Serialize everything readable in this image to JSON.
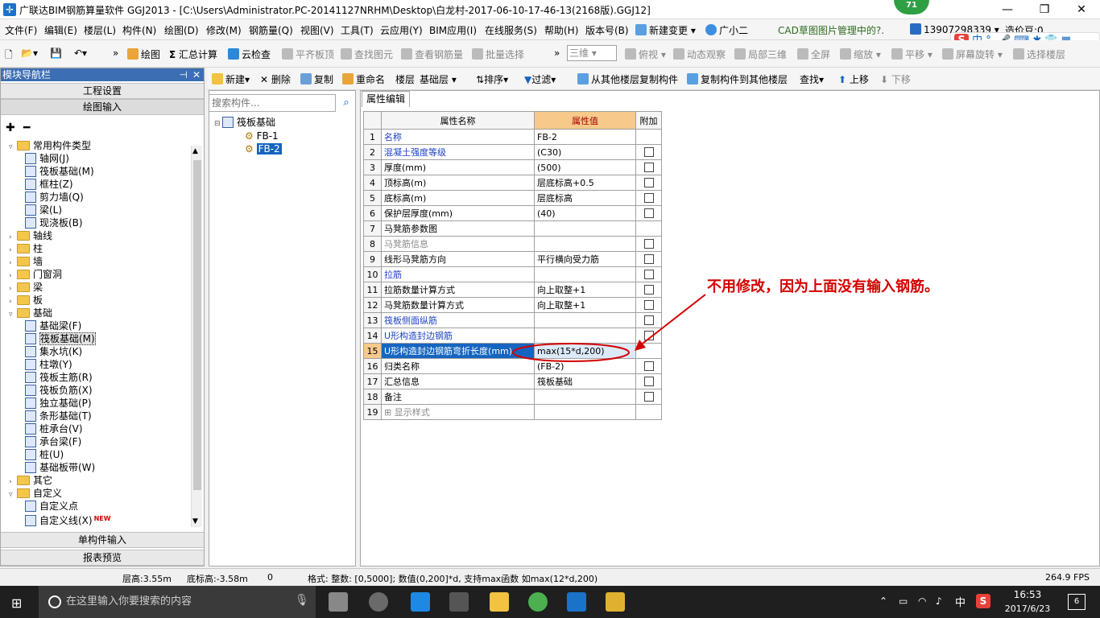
{
  "window": {
    "title": "广联达BIM钢筋算量软件 GGJ2013 - [C:\\Users\\Administrator.PC-20141127NRHM\\Desktop\\白龙村-2017-06-10-17-46-13(2168版).GGJ12]",
    "badge": "71"
  },
  "menu": {
    "items": [
      "文件(F)",
      "编辑(E)",
      "楼层(L)",
      "构件(N)",
      "绘图(D)",
      "修改(M)",
      "钢筋量(Q)",
      "视图(V)",
      "工具(T)",
      "云应用(Y)",
      "BIM应用(I)",
      "在线服务(S)",
      "帮助(H)",
      "版本号(B)",
      "新建变更",
      "广小二"
    ],
    "cad_notice": "CAD草图图片管理中的?.",
    "phone": "13907298339",
    "price": "造价豆:0"
  },
  "toolbar1": {
    "draw": "绘图",
    "sum": "汇总计算",
    "cloud_check": "云检查",
    "flat_top": "平齐板顶",
    "find_elem": "查找图元",
    "view_rebar": "查看钢筋量",
    "batch_select": "批量选择",
    "view_mode": "三维",
    "top_view": "俯视",
    "dynamic": "动态观察",
    "local3d": "局部三维",
    "fullscreen": "全屏",
    "zoom": "缩放",
    "pan": "平移",
    "rotate": "屏幕旋转",
    "select_floor": "选择楼层"
  },
  "toolbar2": {
    "new": "新建",
    "delete": "删除",
    "copy": "复制",
    "rename": "重命名",
    "floor_label": "楼层",
    "floor_value": "基础层",
    "sort": "排序",
    "filter": "过滤",
    "copy_from": "从其他楼层复制构件",
    "copy_to": "复制构件到其他楼层",
    "find": "查找",
    "move_up": "上移",
    "move_down": "下移"
  },
  "nav": {
    "header": "模块导航栏",
    "project_settings": "工程设置",
    "drawing_input": "绘图输入",
    "single_input": "单构件输入",
    "report_preview": "报表预览",
    "tree": [
      {
        "label": "常用构件类型",
        "level": 0,
        "type": "folder",
        "expanded": true
      },
      {
        "label": "轴网(J)",
        "level": 1,
        "type": "item"
      },
      {
        "label": "筏板基础(M)",
        "level": 1,
        "type": "item"
      },
      {
        "label": "框柱(Z)",
        "level": 1,
        "type": "item"
      },
      {
        "label": "剪力墙(Q)",
        "level": 1,
        "type": "item"
      },
      {
        "label": "梁(L)",
        "level": 1,
        "type": "item"
      },
      {
        "label": "现浇板(B)",
        "level": 1,
        "type": "item"
      },
      {
        "label": "轴线",
        "level": 0,
        "type": "folder",
        "expanded": false
      },
      {
        "label": "柱",
        "level": 0,
        "type": "folder",
        "expanded": false
      },
      {
        "label": "墙",
        "level": 0,
        "type": "folder",
        "expanded": false
      },
      {
        "label": "门窗洞",
        "level": 0,
        "type": "folder",
        "expanded": false
      },
      {
        "label": "梁",
        "level": 0,
        "type": "folder",
        "expanded": false
      },
      {
        "label": "板",
        "level": 0,
        "type": "folder",
        "expanded": false
      },
      {
        "label": "基础",
        "level": 0,
        "type": "folder",
        "expanded": true
      },
      {
        "label": "基础梁(F)",
        "level": 1,
        "type": "item"
      },
      {
        "label": "筏板基础(M)",
        "level": 1,
        "type": "item",
        "selected": true
      },
      {
        "label": "集水坑(K)",
        "level": 1,
        "type": "item"
      },
      {
        "label": "柱墩(Y)",
        "level": 1,
        "type": "item"
      },
      {
        "label": "筏板主筋(R)",
        "level": 1,
        "type": "item"
      },
      {
        "label": "筏板负筋(X)",
        "level": 1,
        "type": "item"
      },
      {
        "label": "独立基础(P)",
        "level": 1,
        "type": "item"
      },
      {
        "label": "条形基础(T)",
        "level": 1,
        "type": "item"
      },
      {
        "label": "桩承台(V)",
        "level": 1,
        "type": "item"
      },
      {
        "label": "承台梁(F)",
        "level": 1,
        "type": "item"
      },
      {
        "label": "桩(U)",
        "level": 1,
        "type": "item"
      },
      {
        "label": "基础板带(W)",
        "level": 1,
        "type": "item"
      },
      {
        "label": "其它",
        "level": 0,
        "type": "folder",
        "expanded": false
      },
      {
        "label": "自定义",
        "level": 0,
        "type": "folder",
        "expanded": true
      },
      {
        "label": "自定义点",
        "level": 1,
        "type": "item"
      },
      {
        "label": "自定义线(X)",
        "level": 1,
        "type": "item",
        "new": true
      }
    ]
  },
  "component_list": {
    "search_placeholder": "搜索构件...",
    "root": "筏板基础",
    "items": [
      "FB-1",
      "FB-2"
    ],
    "selected": "FB-2"
  },
  "props": {
    "tab": "属性编辑",
    "headers": [
      "属性名称",
      "属性值",
      "附加"
    ],
    "rows": [
      {
        "num": "1",
        "name": "名称",
        "value": "FB-2",
        "style": "blue",
        "check": false
      },
      {
        "num": "2",
        "name": "混凝土强度等级",
        "value": "(C30)",
        "style": "blue",
        "check": true
      },
      {
        "num": "3",
        "name": "厚度(mm)",
        "value": "(500)",
        "style": "",
        "check": true
      },
      {
        "num": "4",
        "name": "顶标高(m)",
        "value": "层底标高+0.5",
        "style": "",
        "check": true
      },
      {
        "num": "5",
        "name": "底标高(m)",
        "value": "层底标高",
        "style": "",
        "check": true
      },
      {
        "num": "6",
        "name": "保护层厚度(mm)",
        "value": "(40)",
        "style": "",
        "check": true
      },
      {
        "num": "7",
        "name": "马凳筋参数图",
        "value": "",
        "style": "",
        "check": false
      },
      {
        "num": "8",
        "name": "马凳筋信息",
        "value": "",
        "style": "gray",
        "check": true
      },
      {
        "num": "9",
        "name": "线形马凳筋方向",
        "value": "平行横向受力筋",
        "style": "",
        "check": true
      },
      {
        "num": "10",
        "name": "拉筋",
        "value": "",
        "style": "blue",
        "check": true
      },
      {
        "num": "11",
        "name": "拉筋数量计算方式",
        "value": "向上取整+1",
        "style": "",
        "check": true
      },
      {
        "num": "12",
        "name": "马凳筋数量计算方式",
        "value": "向上取整+1",
        "style": "",
        "check": true
      },
      {
        "num": "13",
        "name": "筏板侧面纵筋",
        "value": "",
        "style": "blue",
        "check": true
      },
      {
        "num": "14",
        "name": "U形构造封边钢筋",
        "value": "",
        "style": "blue",
        "check": true
      },
      {
        "num": "15",
        "name": "U形构造封边钢筋弯折长度(mm)",
        "value": "max(15*d,200)",
        "style": "",
        "check": false,
        "selected": true
      },
      {
        "num": "16",
        "name": "归类名称",
        "value": "(FB-2)",
        "style": "",
        "check": true
      },
      {
        "num": "17",
        "name": "汇总信息",
        "value": "筏板基础",
        "style": "",
        "check": true
      },
      {
        "num": "18",
        "name": "备注",
        "value": "",
        "style": "",
        "check": true
      },
      {
        "num": "19",
        "name": "显示样式",
        "value": "",
        "style": "gray",
        "check": false,
        "expander": true
      }
    ]
  },
  "annotation": "不用修改，因为上面没有输入钢筋。",
  "status": {
    "floor_height": "层高:3.55m",
    "floor_bottom": "底标高:-3.58m",
    "zero": "0",
    "format": "格式: 整数: [0,5000]; 数值(0,200]*d, 支持max函数 如max(12*d,200)",
    "fps": "264.9 FPS"
  },
  "taskbar": {
    "search_placeholder": "在这里输入你要搜索的内容",
    "ime": "中",
    "time": "16:53",
    "date": "2017/6/23",
    "notif": "6"
  }
}
